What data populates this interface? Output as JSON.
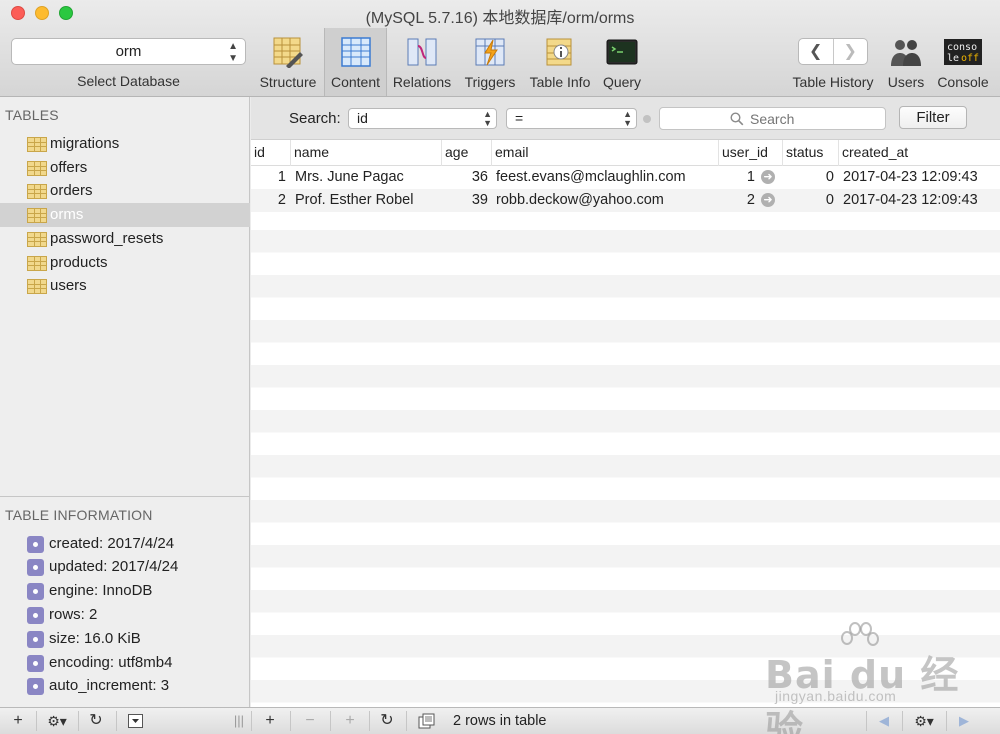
{
  "window": {
    "title": "(MySQL 5.7.16) 本地数据库/orm/orms"
  },
  "toolbar": {
    "database_select": {
      "value": "orm",
      "caption": "Select Database"
    },
    "tools": [
      {
        "label": "Structure"
      },
      {
        "label": "Content"
      },
      {
        "label": "Relations"
      },
      {
        "label": "Triggers"
      },
      {
        "label": "Table Info"
      },
      {
        "label": "Query"
      }
    ],
    "right_tools": [
      {
        "label": "Table History"
      },
      {
        "label": "Users"
      },
      {
        "label": "Console"
      }
    ],
    "active_tool": "Content"
  },
  "sidebar": {
    "tables_header": "TABLES",
    "tables": [
      {
        "name": "migrations"
      },
      {
        "name": "offers"
      },
      {
        "name": "orders"
      },
      {
        "name": "orms"
      },
      {
        "name": "password_resets"
      },
      {
        "name": "products"
      },
      {
        "name": "users"
      }
    ],
    "selected_table": "orms",
    "info_header": "TABLE INFORMATION",
    "info": [
      {
        "text": "created: 2017/4/24"
      },
      {
        "text": "updated: 2017/4/24"
      },
      {
        "text": "engine: InnoDB"
      },
      {
        "text": "rows: 2"
      },
      {
        "text": "size: 16.0 KiB"
      },
      {
        "text": "encoding: utf8mb4"
      },
      {
        "text": "auto_increment: 3"
      }
    ]
  },
  "filter": {
    "search_label": "Search:",
    "field": "id",
    "operator": "=",
    "placeholder": "Search",
    "button": "Filter"
  },
  "table": {
    "columns": [
      "id",
      "name",
      "age",
      "email",
      "user_id",
      "status",
      "created_at"
    ],
    "rows": [
      {
        "id": "1",
        "name": "Mrs. June Pagac",
        "age": "36",
        "email": "feest.evans@mclaughlin.com",
        "user_id": "1",
        "status": "0",
        "created_at": "2017-04-23 12:09:43"
      },
      {
        "id": "2",
        "name": "Prof. Esther Robel",
        "age": "39",
        "email": "robb.deckow@yahoo.com",
        "user_id": "2",
        "status": "0",
        "created_at": "2017-04-23 12:09:43"
      }
    ]
  },
  "bottom": {
    "rows_info": "2 rows in table",
    "add": "+",
    "remove": "−",
    "duplicate": "+",
    "refresh": "↻",
    "gear": "⚙▾",
    "prev": "◀",
    "next": "▶"
  },
  "watermark": {
    "brand": "Bai du 经验",
    "url": "jingyan.baidu.com"
  }
}
